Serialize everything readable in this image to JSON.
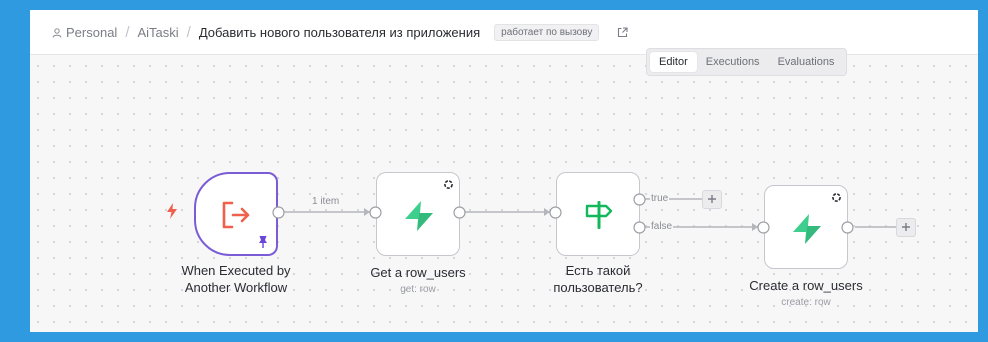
{
  "breadcrumb": {
    "items": [
      "Personal",
      "AiTaski",
      "Добавить нового пользователя из приложения"
    ],
    "badge": "работает по вызову"
  },
  "tabs": [
    "Editor",
    "Executions",
    "Evaluations"
  ],
  "active_tab": "Editor",
  "nodes": {
    "trigger": {
      "title_line1": "When Executed by",
      "title_line2": "Another Workflow"
    },
    "get": {
      "title": "Get a row_users",
      "subtitle": "get: row"
    },
    "if": {
      "title_line1": "Есть такой",
      "title_line2": "пользователь?"
    },
    "create": {
      "title": "Create a row_users",
      "subtitle": "create: row"
    }
  },
  "edges": {
    "items_label": "1 item",
    "true_label": "true",
    "false_label": "false"
  },
  "colors": {
    "frame": "#2f9ae0",
    "trigger_border": "#7b5bd6",
    "trigger_icon": "#f0604d",
    "supabase_green": "#3ecf8e",
    "if_icon": "#14b85c",
    "pin": "#6a45d8"
  },
  "icons": {
    "trigger": "sign-in-arrow-icon",
    "lightning": "lightning-icon",
    "pin": "pin-icon",
    "supabase": "supabase-bolt-icon",
    "if": "signpost-icon",
    "settings": "settings-dot-icon",
    "plus": "plus-icon",
    "external": "external-link-icon",
    "person": "person-icon"
  }
}
